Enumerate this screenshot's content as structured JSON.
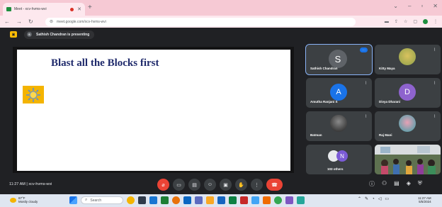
{
  "browser": {
    "tab_title": "Meet - xcv-hvms-wvi",
    "url": "meet.google.com/xcv-hvms-wvi"
  },
  "meet": {
    "presenter_initial": "S",
    "presenting_text": "Sathish Chandran is presenting",
    "slide_title": "Blast all the Blocks first",
    "participants": [
      {
        "name": "Sathish Chandran",
        "initial": "S",
        "avatar_color": "#5f6368"
      },
      {
        "name": "Kitty Maya",
        "initial": "",
        "avatar_color": "#a8b85a"
      },
      {
        "name": "Amutha Ranjani S",
        "initial": "A",
        "avatar_color": "#1a73e8"
      },
      {
        "name": "Divya Dharani",
        "initial": "D",
        "avatar_color": "#8e63ce"
      },
      {
        "name": "Batman",
        "initial": "",
        "avatar_color": "#2b2b2b"
      },
      {
        "name": "Raj Mani",
        "initial": "",
        "avatar_color": "#3aa0a8"
      }
    ],
    "others_initial": "N",
    "others_label": "103 others",
    "time": "11:27 AM",
    "meeting_code": "xcv-hvms-wvi",
    "separator": "|"
  },
  "taskbar": {
    "weather_temp": "87°F",
    "weather_desc": "Mostly cloudy",
    "search_placeholder": "Search",
    "clock_time": "11:27 AM",
    "clock_date": "5/5/2024"
  },
  "colors": {
    "meet_bg": "#202124",
    "tab_strip": "#f6c9d4",
    "end_call": "#ea4335",
    "slide_title": "#1f2a6b",
    "sun_box": "#f4b400"
  }
}
